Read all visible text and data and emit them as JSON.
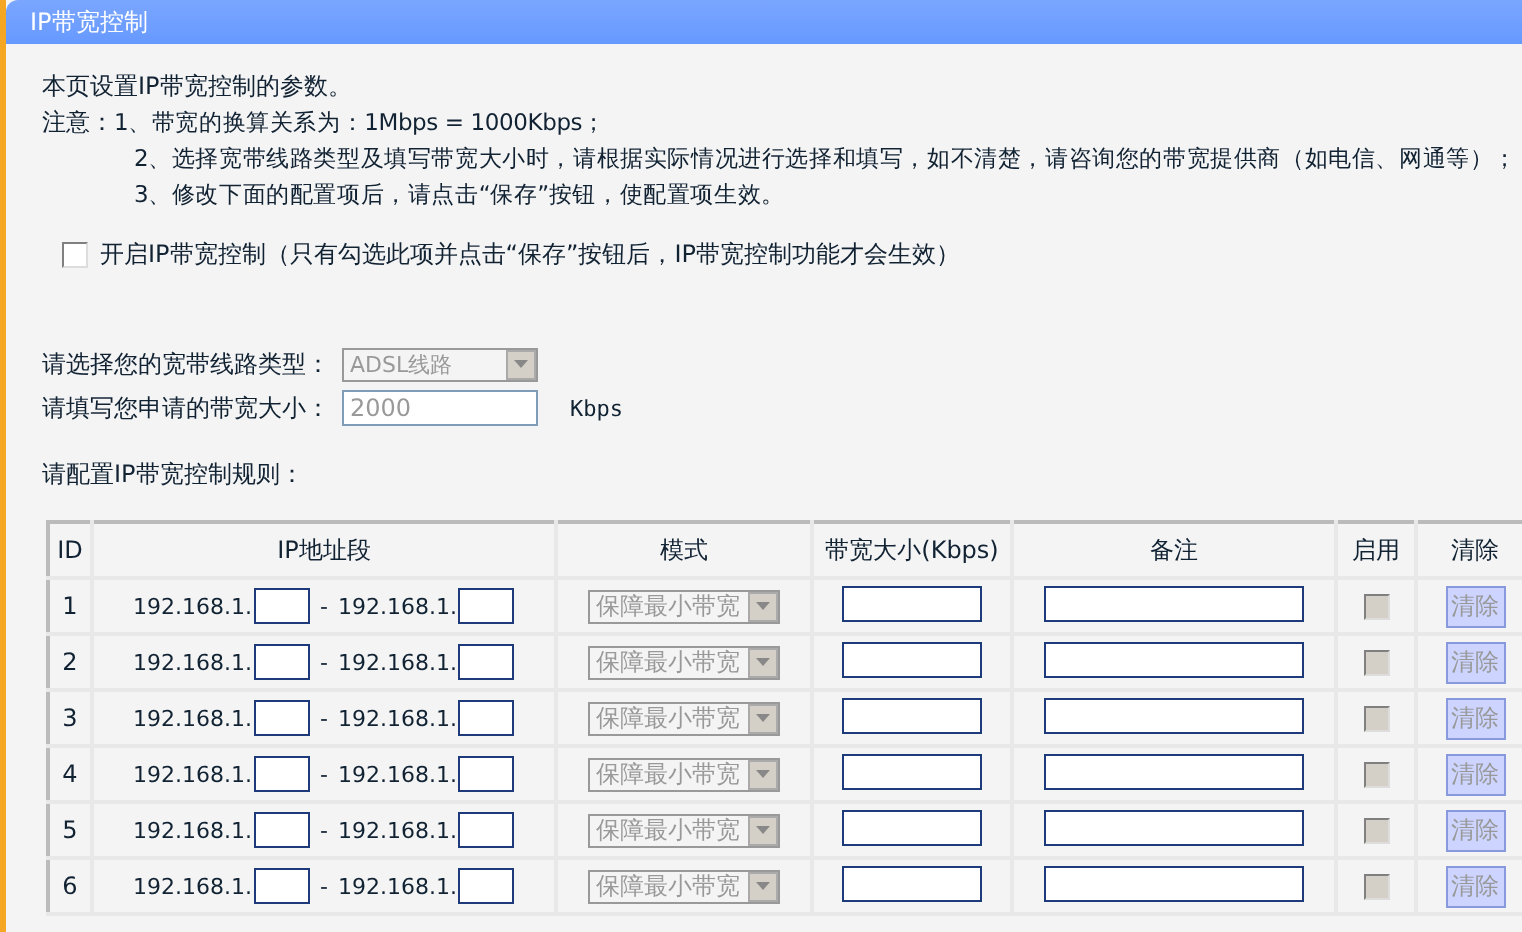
{
  "title": "IP带宽控制",
  "intro": "本页设置IP带宽控制的参数。",
  "notes_label": "注意：",
  "notes": [
    "1、带宽的换算关系为：1Mbps = 1000Kbps；",
    "2、选择宽带线路类型及填写带宽大小时，请根据实际情况进行选择和填写，如不清楚，请咨询您的带宽提供商（如电信、网通等）；",
    "3、修改下面的配置项后，请点击“保存”按钮，使配置项生效。"
  ],
  "enable": {
    "label": "开启IP带宽控制（只有勾选此项并点击“保存”按钮后，IP带宽控制功能才会生效）",
    "checked": false
  },
  "line_type": {
    "label": "请选择您的宽带线路类型：",
    "value": "ADSL线路",
    "disabled": true
  },
  "bandwidth": {
    "label": "请填写您申请的带宽大小：",
    "value": "2000",
    "unit": "Kbps",
    "disabled": true
  },
  "rules_label": "请配置IP带宽控制规则：",
  "table": {
    "columns": [
      "ID",
      "IP地址段",
      "模式",
      "带宽大小(Kbps)",
      "备注",
      "启用",
      "清除"
    ],
    "rows": [
      {
        "id": "1",
        "prefix_start": "192.168.1.",
        "dash": "-",
        "prefix_end": "192.168.1.",
        "mode": "保障最小带宽",
        "enabled": false,
        "disabled": true,
        "clear": "清除"
      },
      {
        "id": "2",
        "prefix_start": "192.168.1.",
        "dash": "-",
        "prefix_end": "192.168.1.",
        "mode": "保障最小带宽",
        "enabled": false,
        "disabled": true,
        "clear": "清除"
      },
      {
        "id": "3",
        "prefix_start": "192.168.1.",
        "dash": "-",
        "prefix_end": "192.168.1.",
        "mode": "保障最小带宽",
        "enabled": false,
        "disabled": true,
        "clear": "清除"
      },
      {
        "id": "4",
        "prefix_start": "192.168.1.",
        "dash": "-",
        "prefix_end": "192.168.1.",
        "mode": "保障最小带宽",
        "enabled": false,
        "disabled": true,
        "clear": "清除"
      },
      {
        "id": "5",
        "prefix_start": "192.168.1.",
        "dash": "-",
        "prefix_end": "192.168.1.",
        "mode": "保障最小带宽",
        "enabled": false,
        "disabled": true,
        "clear": "清除"
      },
      {
        "id": "6",
        "prefix_start": "192.168.1.",
        "dash": "-",
        "prefix_end": "192.168.1.",
        "mode": "保障最小带宽",
        "enabled": false,
        "disabled": true,
        "clear": "清除"
      }
    ]
  }
}
